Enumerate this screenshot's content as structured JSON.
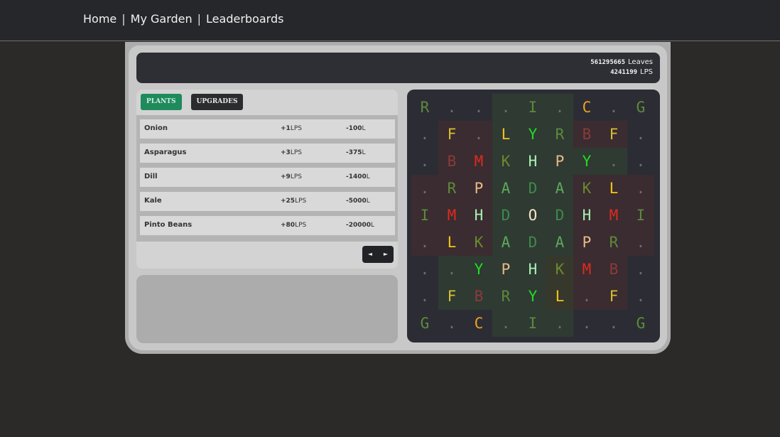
{
  "nav": {
    "links": [
      "Home",
      "My Garden",
      "Leaderboards"
    ],
    "separator": "|"
  },
  "stats": {
    "leaves_value": "561295665",
    "leaves_label": "Leaves",
    "lps_value": "4241199",
    "lps_label": "LPS"
  },
  "shop": {
    "tabs": [
      "PLANTS",
      "UPGRADES"
    ],
    "active_tab": "PLANTS",
    "items": [
      {
        "name": "Onion",
        "lps_value": "+1",
        "lps_unit": "LPS",
        "cost_value": "-100",
        "cost_unit": "L"
      },
      {
        "name": "Asparagus",
        "lps_value": "+3",
        "lps_unit": "LPS",
        "cost_value": "-375",
        "cost_unit": "L"
      },
      {
        "name": "Dill",
        "lps_value": "+9",
        "lps_unit": "LPS",
        "cost_value": "-1400",
        "cost_unit": "L"
      },
      {
        "name": "Kale",
        "lps_value": "+25",
        "lps_unit": "LPS",
        "cost_value": "-5000",
        "cost_unit": "L"
      },
      {
        "name": "Pinto Beans",
        "lps_value": "+80",
        "lps_unit": "LPS",
        "cost_value": "-20000",
        "cost_unit": "L"
      }
    ],
    "pager": {
      "prev": "◄",
      "next": "►"
    }
  },
  "garden": {
    "rows": [
      [
        "R",
        ".",
        ".",
        ".",
        "I",
        ".",
        "C",
        ".",
        "G"
      ],
      [
        ".",
        "F",
        ".",
        "L",
        "Y",
        "R",
        "B",
        "F",
        "."
      ],
      [
        ".",
        "B",
        "M",
        "K",
        "H",
        "P",
        "Y",
        ".",
        "."
      ],
      [
        ".",
        "R",
        "P",
        "A",
        "D",
        "A",
        "K",
        "L",
        "."
      ],
      [
        "I",
        "M",
        "H",
        "D",
        "O",
        "D",
        "H",
        "M",
        "I"
      ],
      [
        ".",
        "L",
        "K",
        "A",
        "D",
        "A",
        "P",
        "R",
        "."
      ],
      [
        ".",
        ".",
        "Y",
        "P",
        "H",
        "K",
        "M",
        "B",
        "."
      ],
      [
        ".",
        "F",
        "B",
        "R",
        "Y",
        "L",
        ".",
        "F",
        "."
      ],
      [
        "G",
        ".",
        "C",
        ".",
        "I",
        ".",
        ".",
        ".",
        "G"
      ]
    ],
    "colors": {
      "R": "#5d8a3c",
      "I": "#5d8a3c",
      "G": "#5d8a3c",
      "C": "#f0a020",
      "F": "#d4c030",
      "L": "#f5c518",
      "Y": "#22dd22",
      "B": "#8b3a3a",
      "M": "#e02a1e",
      "K": "#6b8a2e",
      "H": "#a8f0b4",
      "P": "#e8b888",
      "A": "#5aaa5a",
      "D": "#3f8a4a",
      "O": "#f5e6c8",
      ".": "#6c6e74"
    },
    "tints": [
      [
        null,
        null,
        null,
        "g",
        "g",
        "g",
        null,
        null,
        null
      ],
      [
        null,
        "r",
        "r",
        "g",
        "g",
        "g",
        "r",
        "r",
        null
      ],
      [
        null,
        "r",
        "r",
        "g",
        "g",
        "g",
        "g",
        "g",
        null
      ],
      [
        "r",
        "r",
        "r",
        "g",
        "g",
        "g",
        "r",
        "r",
        "r"
      ],
      [
        "r",
        "r",
        "r",
        "g",
        "g",
        "g",
        "r",
        "r",
        "r"
      ],
      [
        "r",
        "r",
        "r",
        "g",
        "g",
        "g",
        "r",
        "r",
        "r"
      ],
      [
        null,
        "g",
        "g",
        "g",
        "g",
        "y",
        "r",
        "r",
        null
      ],
      [
        null,
        "g",
        "g",
        "g",
        "g",
        "y",
        "r",
        "r",
        null
      ],
      [
        null,
        null,
        null,
        "g",
        "g",
        "g",
        null,
        null,
        null
      ]
    ],
    "tint_colors": {
      "r": "#3a2c30",
      "g": "#2f3a33",
      "y": "#37382c"
    }
  }
}
